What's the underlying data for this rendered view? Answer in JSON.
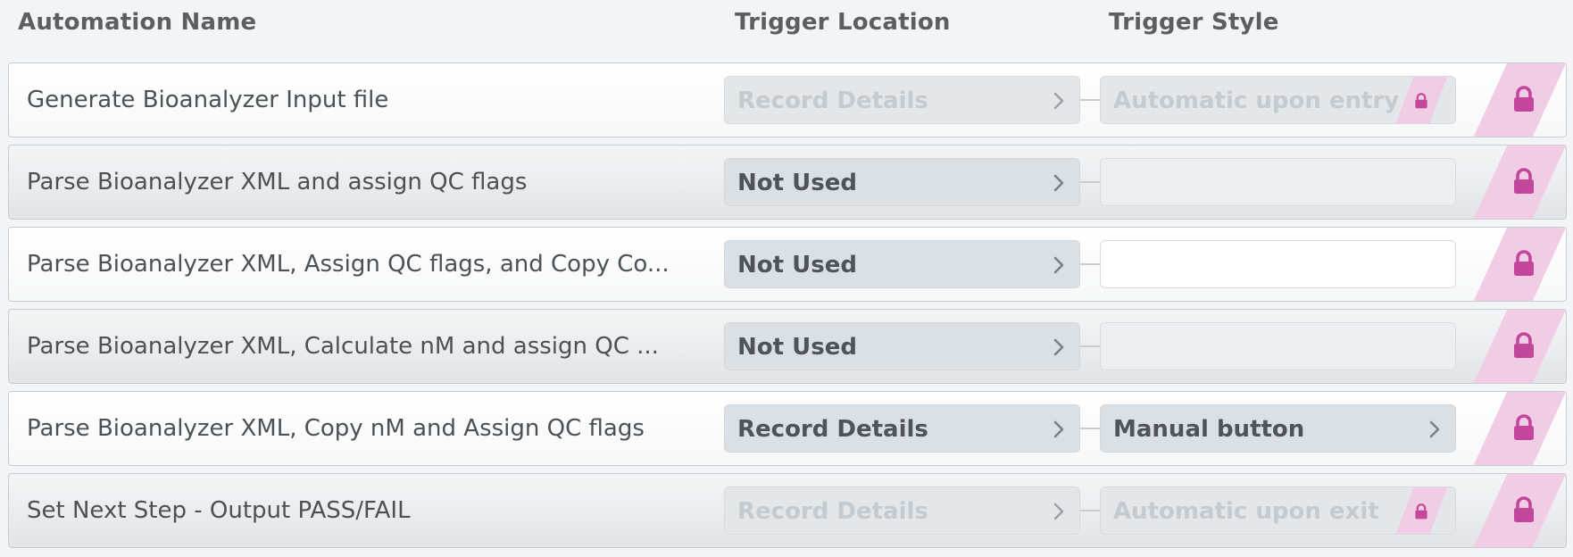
{
  "header": {
    "name_col": "Automation Name",
    "location_col": "Trigger Location",
    "style_col": "Trigger Style"
  },
  "colors": {
    "lock": "#c2479b",
    "stripe": "#f0cde5",
    "chevron_disabled": "#c3cbd1",
    "chevron_active": "#7a8187"
  },
  "rows": [
    {
      "name": "Generate Bioanalyzer Input file",
      "location": "Record Details",
      "style": "Automatic upon entry",
      "state": "disabled"
    },
    {
      "name": "Parse Bioanalyzer XML and assign QC flags",
      "location": "Not Used",
      "style": "",
      "state": "notused"
    },
    {
      "name": "Parse Bioanalyzer XML, Assign QC flags, and Copy Co...",
      "location": "Not Used",
      "style": "",
      "state": "notused"
    },
    {
      "name": "Parse Bioanalyzer XML, Calculate nM and assign QC ...",
      "location": "Not Used",
      "style": "",
      "state": "notused"
    },
    {
      "name": "Parse Bioanalyzer XML, Copy nM and Assign QC flags",
      "location": "Record Details",
      "style": "Manual button",
      "state": "active"
    },
    {
      "name": "Set Next Step - Output PASS/FAIL",
      "location": "Record Details",
      "style": "Automatic upon exit",
      "state": "disabled"
    }
  ]
}
